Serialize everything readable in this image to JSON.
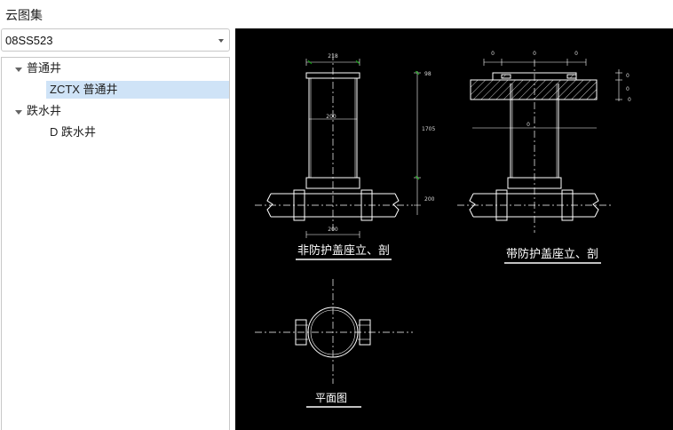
{
  "app": {
    "title": "云图集"
  },
  "atlas_select": {
    "value": "08SS523"
  },
  "tree": {
    "nodes": [
      {
        "label": "普通井",
        "expanded": true
      },
      {
        "label": "ZCTX 普通井",
        "selected": true
      },
      {
        "label": "跌水井",
        "expanded": true
      },
      {
        "label": "D 跌水井"
      }
    ]
  },
  "drawing": {
    "captions": {
      "left_section": "非防护盖座立、剖",
      "right_section": "带防护盖座立、剖",
      "plan": "平面图"
    },
    "dimensions": {
      "top_width": "218",
      "inner_width": "200",
      "bottom_width": "200",
      "height_top": "98",
      "height_mid": "1705",
      "height_bottom": "200",
      "right_zero": "0"
    },
    "colors": {
      "background": "#000000",
      "lines": "#ffffff",
      "dimension_marks": "#00d000",
      "selection": "#cfe3f7"
    }
  }
}
